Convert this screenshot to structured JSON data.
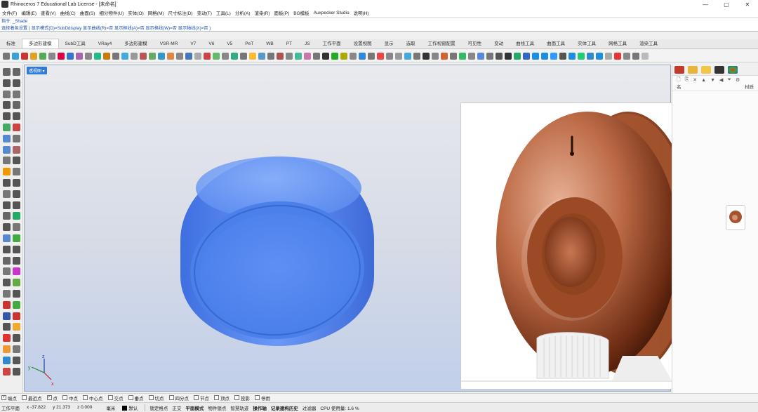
{
  "window": {
    "title": "Rhinoceros 7 Educational Lab License - [未命名]",
    "controls": {
      "minimize": "—",
      "maximize": "▢",
      "close": "✕"
    }
  },
  "menu": [
    "文件(F)",
    "编辑(E)",
    "查看(V)",
    "曲线(C)",
    "曲面(S)",
    "细分物件(U)",
    "实体(O)",
    "网格(M)",
    "尺寸标注(D)",
    "变动(T)",
    "工具(L)",
    "分析(A)",
    "渲染(R)",
    "面板(P)",
    "BG模板",
    "Auxpecker Studio",
    "说明(H)"
  ],
  "command": {
    "line1": "指令: _Shade",
    "line2": "选择着色设置 ( 显示模式(D)=SubDdisplay  显示曲线(R)=否  显示框线(A)=否  显示格线(W)=否  显示轴线(X)=否 )"
  },
  "tabs": [
    "标准",
    "多边形建模",
    "SubD工具",
    "VRay4",
    "多边形建模",
    "VSR-MR",
    "V7",
    "V6",
    "V5",
    "PeT",
    "WB",
    "PT",
    "JS",
    "工作平面",
    "设置视图",
    "显示",
    "选取",
    "工作视窗配置",
    "可见性",
    "变动",
    "曲线工具",
    "曲面工具",
    "实体工具",
    "网格工具",
    "渲染工具"
  ],
  "active_tab_index": 1,
  "viewport": {
    "label": "透视图 ▾",
    "axes": {
      "x": "x",
      "y": "y",
      "z": "z"
    }
  },
  "right_panel": {
    "tools": [
      "🗋",
      "⎘",
      "✕",
      "▲",
      "▼",
      "◀",
      "⏷",
      "⚙"
    ],
    "col_name": "名",
    "col_material": "材质"
  },
  "osnap": [
    {
      "label": "端点",
      "checked": true
    },
    {
      "label": "最近点",
      "checked": false
    },
    {
      "label": "点",
      "checked": true
    },
    {
      "label": "中点",
      "checked": false
    },
    {
      "label": "中心点",
      "checked": false
    },
    {
      "label": "交点",
      "checked": false
    },
    {
      "label": "垂点",
      "checked": false
    },
    {
      "label": "切点",
      "checked": false
    },
    {
      "label": "四分点",
      "checked": false
    },
    {
      "label": "节点",
      "checked": false
    },
    {
      "label": "顶点",
      "checked": false
    },
    {
      "label": "投影",
      "checked": false
    },
    {
      "label": "停用",
      "checked": false
    }
  ],
  "status": {
    "cplane": "工作平面",
    "x": "x -37.822",
    "y": "y 21.373",
    "z": "z 0.000",
    "units": "毫米",
    "layer": "默认",
    "buttons": [
      "锁定格点",
      "正交",
      "平面模式",
      "物件锁点",
      "智慧轨迹",
      "操作轴",
      "记录建构历史",
      "过滤器",
      "CPU 使用量: 1.6 %"
    ],
    "bold_buttons": [
      "平面模式",
      "操作轴",
      "记录建构历史"
    ]
  },
  "colors": {
    "viewport_top": "#e9eaee",
    "viewport_bottom": "#c1cfea",
    "model_blue": "#5a8cf2",
    "render_copper": "#b0603c",
    "tab_label_bg": "#2f7bd6"
  }
}
